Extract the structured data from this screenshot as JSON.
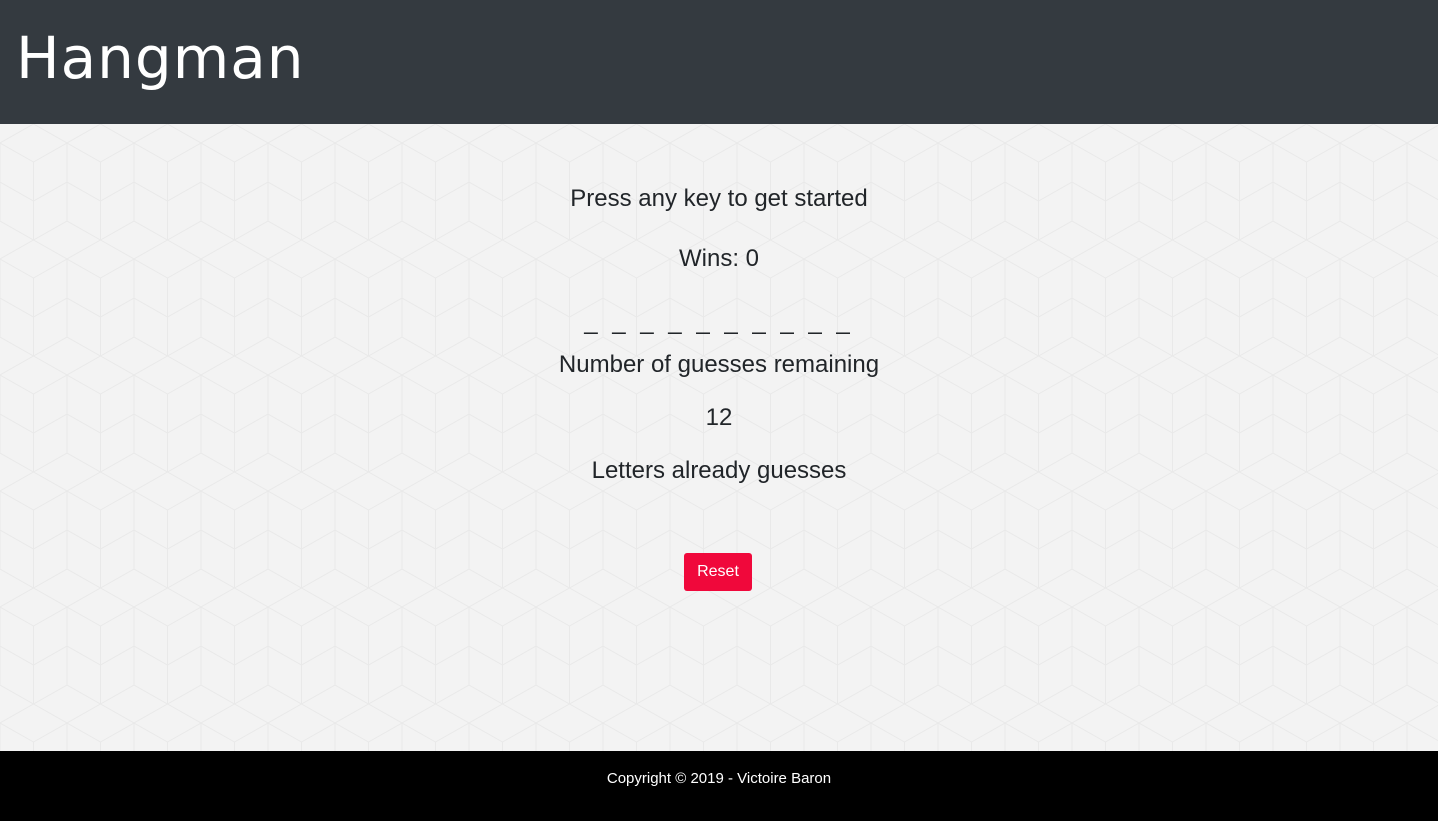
{
  "header": {
    "title": "Hangman",
    "background": "#343a40"
  },
  "game": {
    "prompt": "Press any key to get started",
    "wins": "Wins: 0",
    "word_display": "_ _ _ _ _ _ _ _ _ _",
    "guesses_label": "Number of guesses remaining",
    "guesses_remaining": "12",
    "letters_label": "Letters already guesses",
    "letters_guessed": "",
    "reset_label": "Reset",
    "reset_color": "#f0083b"
  },
  "footer": {
    "text": "Copyright © 2019 - Victoire Baron",
    "background": "#000000"
  }
}
